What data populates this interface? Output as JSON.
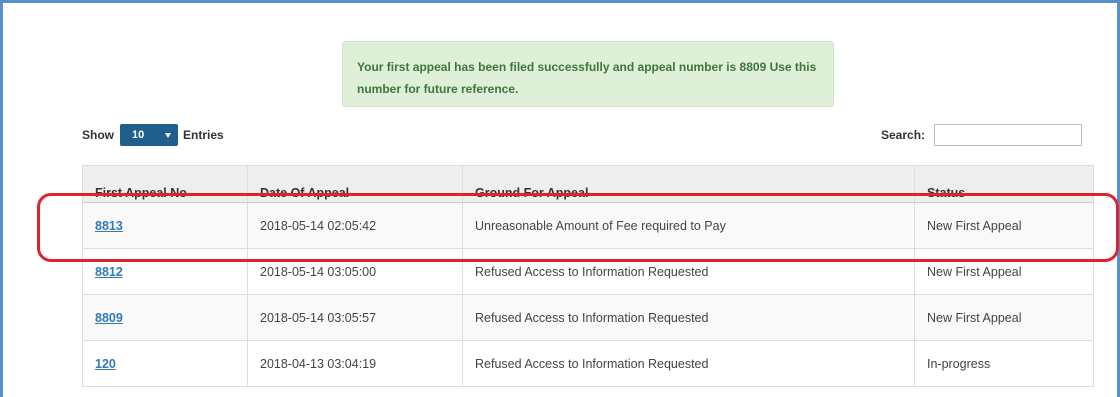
{
  "alert": {
    "message": "Your first appeal has been filed successfully and appeal number is 8809 Use this number for future reference."
  },
  "length": {
    "show_label": "Show",
    "value": "10",
    "entries_label": "Entries"
  },
  "search": {
    "label": "Search:",
    "value": ""
  },
  "table": {
    "headers": [
      "First Appeal No",
      "Date Of Appeal",
      "Ground For Appeal",
      "Status"
    ],
    "rows": [
      {
        "no": "8813",
        "date": "2018-05-14 02:05:42",
        "ground": "Unreasonable Amount of Fee required to Pay",
        "status": "New First Appeal"
      },
      {
        "no": "8812",
        "date": "2018-05-14 03:05:00",
        "ground": "Refused Access to Information Requested",
        "status": "New First Appeal"
      },
      {
        "no": "8809",
        "date": "2018-05-14 03:05:57",
        "ground": "Refused Access to Information Requested",
        "status": "New First Appeal"
      },
      {
        "no": "120",
        "date": "2018-04-13 03:04:19",
        "ground": "Refused Access to Information Requested",
        "status": "In-progress"
      }
    ]
  },
  "colors": {
    "frame_border": "#5b8fc9",
    "alert_bg": "#dff0d8",
    "alert_text": "#3c763d",
    "select_bg": "#1f5f8b",
    "link": "#337ab7",
    "highlight": "#e0222c"
  },
  "icons": {
    "select_caret": "caret-down-icon"
  }
}
